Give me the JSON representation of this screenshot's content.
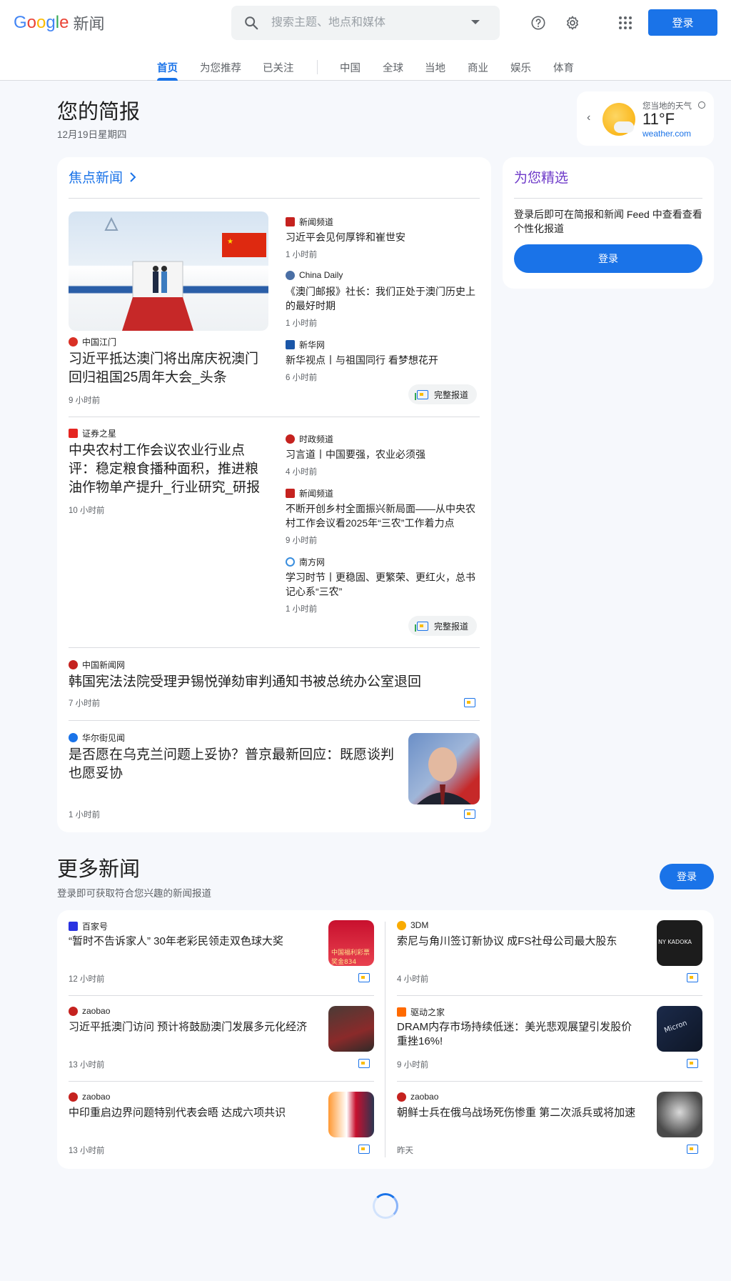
{
  "header": {
    "logo_text": "Google",
    "logo_news": "新闻",
    "search_placeholder": "搜索主题、地点和媒体",
    "login_label": "登录",
    "help_icon": "help-icon",
    "settings_icon": "gear-icon",
    "apps_icon": "apps-grid-icon"
  },
  "tabs": [
    {
      "label": "首页",
      "active": true
    },
    {
      "label": "为您推荐"
    },
    {
      "label": "已关注"
    },
    {
      "label": "中国"
    },
    {
      "label": "全球"
    },
    {
      "label": "当地"
    },
    {
      "label": "商业"
    },
    {
      "label": "娱乐"
    },
    {
      "label": "体育"
    }
  ],
  "briefing": {
    "title": "您的简报",
    "date": "12月19日星期四"
  },
  "weather": {
    "label": "您当地的天气",
    "temp": "11°F",
    "source": "weather.com"
  },
  "top_stories": {
    "title": "焦点新闻",
    "cluster1": {
      "main": {
        "source": "中国江门",
        "headline": "习近平抵达澳门将出席庆祝澳门回归祖国25周年大会_头条",
        "time": "9 小时前"
      },
      "side": [
        {
          "source": "新闻频道",
          "headline": "习近平会见何厚铧和崔世安",
          "time": "1 小时前"
        },
        {
          "source": "China Daily",
          "headline": "《澳门邮报》社长：我们正处于澳门历史上的最好时期",
          "time": "1 小时前"
        },
        {
          "source": "新华网",
          "headline": "新华视点丨与祖国同行 看梦想花开",
          "time": "6 小时前"
        }
      ],
      "full_coverage": "完整报道"
    },
    "cluster2": {
      "main": {
        "source": "证券之星",
        "headline": "中央农村工作会议农业行业点评：稳定粮食播种面积，推进粮油作物单产提升_行业研究_研报",
        "time": "10 小时前"
      },
      "side": [
        {
          "source": "时政频道",
          "headline": "习言道丨中国要强，农业必须强",
          "time": "4 小时前"
        },
        {
          "source": "新闻频道",
          "headline": "不断开创乡村全面振兴新局面——从中央农村工作会议看2025年“三农”工作着力点",
          "time": "9 小时前"
        },
        {
          "source": "南方网",
          "headline": "学习时节丨更稳固、更繁荣、更红火，总书记心系“三农”",
          "time": "1 小时前"
        }
      ],
      "full_coverage": "完整报道"
    },
    "story3": {
      "source": "中国新闻网",
      "headline": "韩国宪法法院受理尹锡悦弹劾审判通知书被总统办公室退回",
      "time": "7 小时前"
    },
    "story4": {
      "source": "华尔街见闻",
      "headline": "是否愿在乌克兰问题上妥协？普京最新回应：既愿谈判也愿妥协",
      "time": "1 小时前"
    }
  },
  "for_you": {
    "title": "为您精选",
    "text": "登录后即可在简报和新闻 Feed 中查看查看个性化报道",
    "button": "登录"
  },
  "more_news": {
    "title": "更多新闻",
    "subtitle": "登录即可获取符合您兴趣的新闻报道",
    "login": "登录",
    "left": [
      {
        "source": "百家号",
        "headline": "“暂时不告诉家人” 30年老彩民领走双色球大奖",
        "time": "12 小时前",
        "img_text": "中国福利彩票 奖金834"
      },
      {
        "source": "zaobao",
        "headline": "习近平抵澳门访问 预计将鼓励澳门发展多元化经济",
        "time": "13 小时前"
      },
      {
        "source": "zaobao",
        "headline": "中印重启边界问题特别代表会晤 达成六项共识",
        "time": "13 小时前"
      }
    ],
    "right": [
      {
        "source": "3DM",
        "headline": "索尼与角川签订新协议 成FS社母公司最大股东",
        "time": "4 小时前",
        "img_text": "NY KADOKA"
      },
      {
        "source": "驱动之家",
        "headline": "DRAM内存市场持续低迷：美光悲观展望引发股价重挫16%!",
        "time": "9 小时前",
        "img_text": "Micron"
      },
      {
        "source": "zaobao",
        "headline": "朝鲜士兵在俄乌战场死伤惨重 第二次派兵或将加速",
        "time": "昨天"
      }
    ]
  },
  "colors": {
    "accent": "#1a73e8",
    "for_you": "#6e3ac9",
    "background": "#f6f8fc"
  }
}
